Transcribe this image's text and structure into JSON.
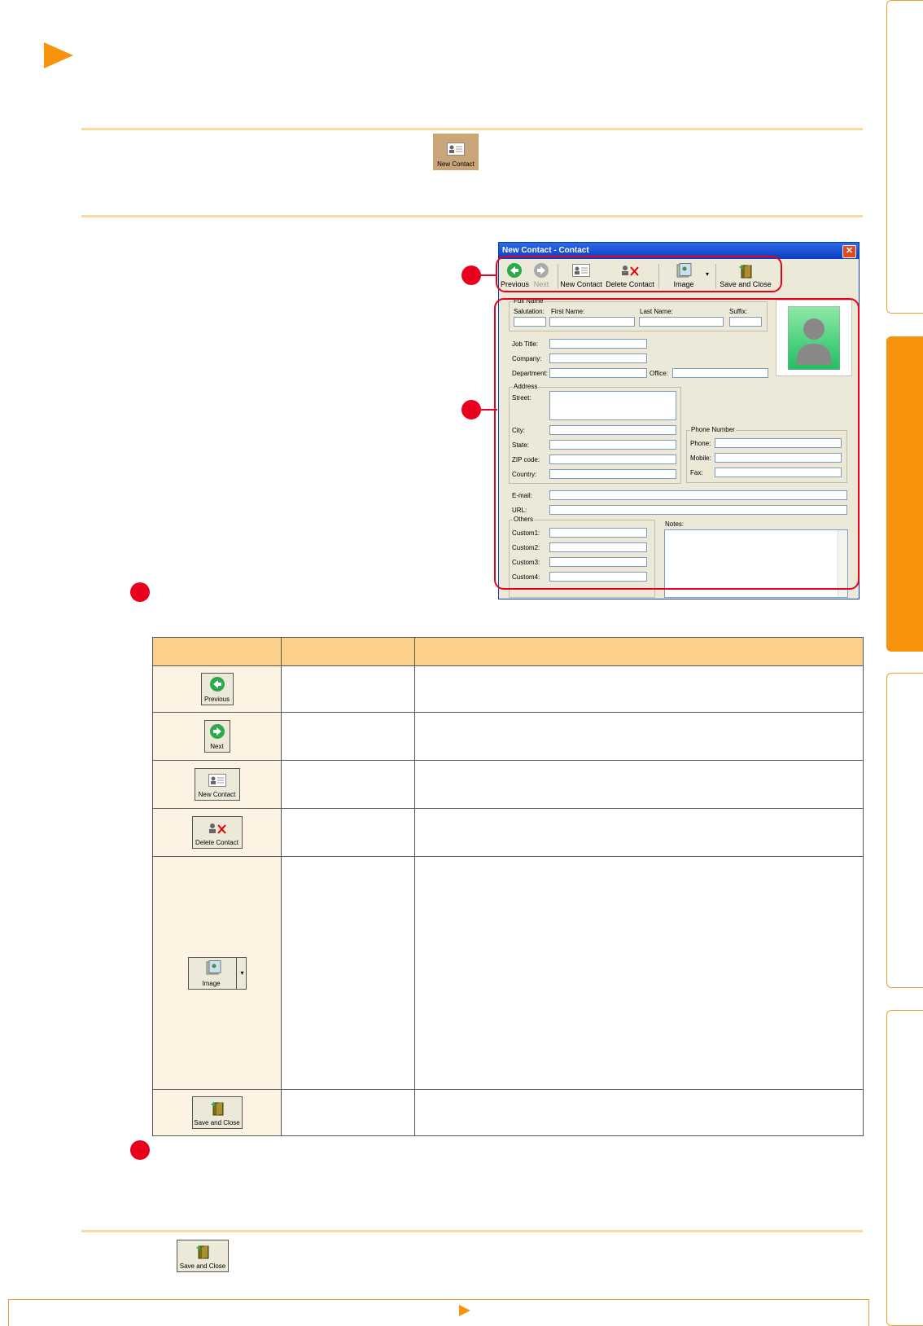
{
  "top_mark": {
    "icon": "play-triangle-icon",
    "color": "#f7930d"
  },
  "intro_button": {
    "label": "New Contact"
  },
  "side_tabs": [
    {
      "state": "normal"
    },
    {
      "state": "active"
    },
    {
      "state": "normal"
    },
    {
      "state": "normal"
    }
  ],
  "dialog": {
    "title": "New Contact - Contact",
    "close_glyph": "✕",
    "toolbar": {
      "previous": "Previous",
      "next": "Next",
      "new_contact": "New Contact",
      "delete_contact": "Delete Contact",
      "image": "Image",
      "save_close": "Save and Close"
    },
    "full_name_group": "Full Name",
    "salutation": "Salutation:",
    "first_name": "First Name:",
    "last_name": "Last Name:",
    "suffix": "Suffix:",
    "job_title": "Job Title:",
    "company": "Company:",
    "department": "Department:",
    "office": "Office:",
    "address_group": "Address",
    "street": "Street:",
    "city": "City:",
    "state": "State:",
    "zip": "ZIP code:",
    "country": "Country:",
    "phone_group": "Phone Number",
    "phone": "Phone:",
    "mobile": "Mobile:",
    "fax": "Fax:",
    "email": "E-mail:",
    "url": "URL:",
    "others_group": "Others",
    "custom1": "Custom1:",
    "custom2": "Custom2:",
    "custom3": "Custom3:",
    "custom4": "Custom4:",
    "notes": "Notes:"
  },
  "table": {
    "rows": [
      {
        "label": "Previous",
        "kind": "previous"
      },
      {
        "label": "Next",
        "kind": "next"
      },
      {
        "label": "New Contact",
        "kind": "new-contact"
      },
      {
        "label": "Delete Contact",
        "kind": "delete-contact"
      },
      {
        "label": "Image",
        "kind": "image"
      },
      {
        "label": "Save and Close",
        "kind": "save-close"
      }
    ]
  },
  "bottom_button": {
    "label": "Save and Close"
  },
  "footer": {
    "icon": "next-page-arrow-icon"
  },
  "colors": {
    "accent": "#f7930d",
    "marker": "#e8001c",
    "header": "#fdd08a"
  }
}
